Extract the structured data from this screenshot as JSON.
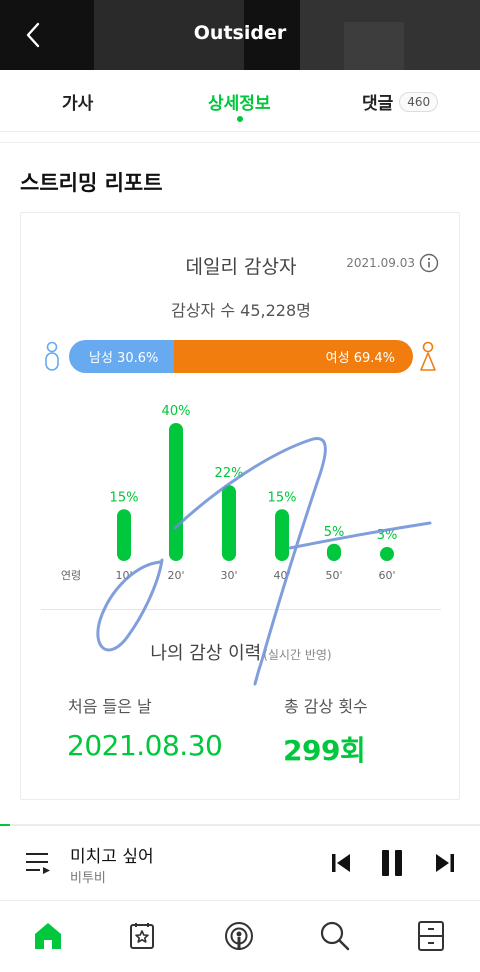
{
  "header": {
    "title": "Outsider"
  },
  "tabs": [
    {
      "label": "가사"
    },
    {
      "label": "상세정보"
    },
    {
      "label": "댓글",
      "count": "460"
    }
  ],
  "section_title": "스트리밍 리포트",
  "daily": {
    "title": "데일리 감상자",
    "date": "2021.09.03",
    "listeners": "감상자 수 45,228명",
    "male_label": "남성 30.6%",
    "female_label": "여성 69.4%",
    "male_share": 0.306
  },
  "chart_data": {
    "type": "bar",
    "xlabel": "연령",
    "categories": [
      "10'",
      "20'",
      "30'",
      "40'",
      "50'",
      "60'"
    ],
    "values": [
      15,
      40,
      22,
      15,
      5,
      3
    ],
    "value_labels": [
      "15%",
      "40%",
      "22%",
      "15%",
      "5%",
      "3%"
    ],
    "colors": [
      "#00c73c",
      "#00c73c",
      "#00c73c",
      "#00c73c",
      "#00c73c",
      "#00c73c"
    ],
    "ylim": [
      0,
      40
    ]
  },
  "history": {
    "title": "나의 감상 이력",
    "subtitle": "(실시간 반영)",
    "first_label": "처음 들은 날",
    "first_value": "2021.08.30",
    "count_label": "총 감상 횟수",
    "count_value": "299회"
  },
  "player": {
    "song": "미치고 싶어",
    "artist": "비투비",
    "progress": 0.02
  },
  "nav": [
    "home-icon",
    "playlist-library-icon",
    "podcast-icon",
    "search-icon",
    "storage-box-icon"
  ],
  "colors": {
    "accent": "#00c73c",
    "male": "#67aaf0",
    "female": "#f07d0e",
    "signature": "#6b8ed6"
  }
}
